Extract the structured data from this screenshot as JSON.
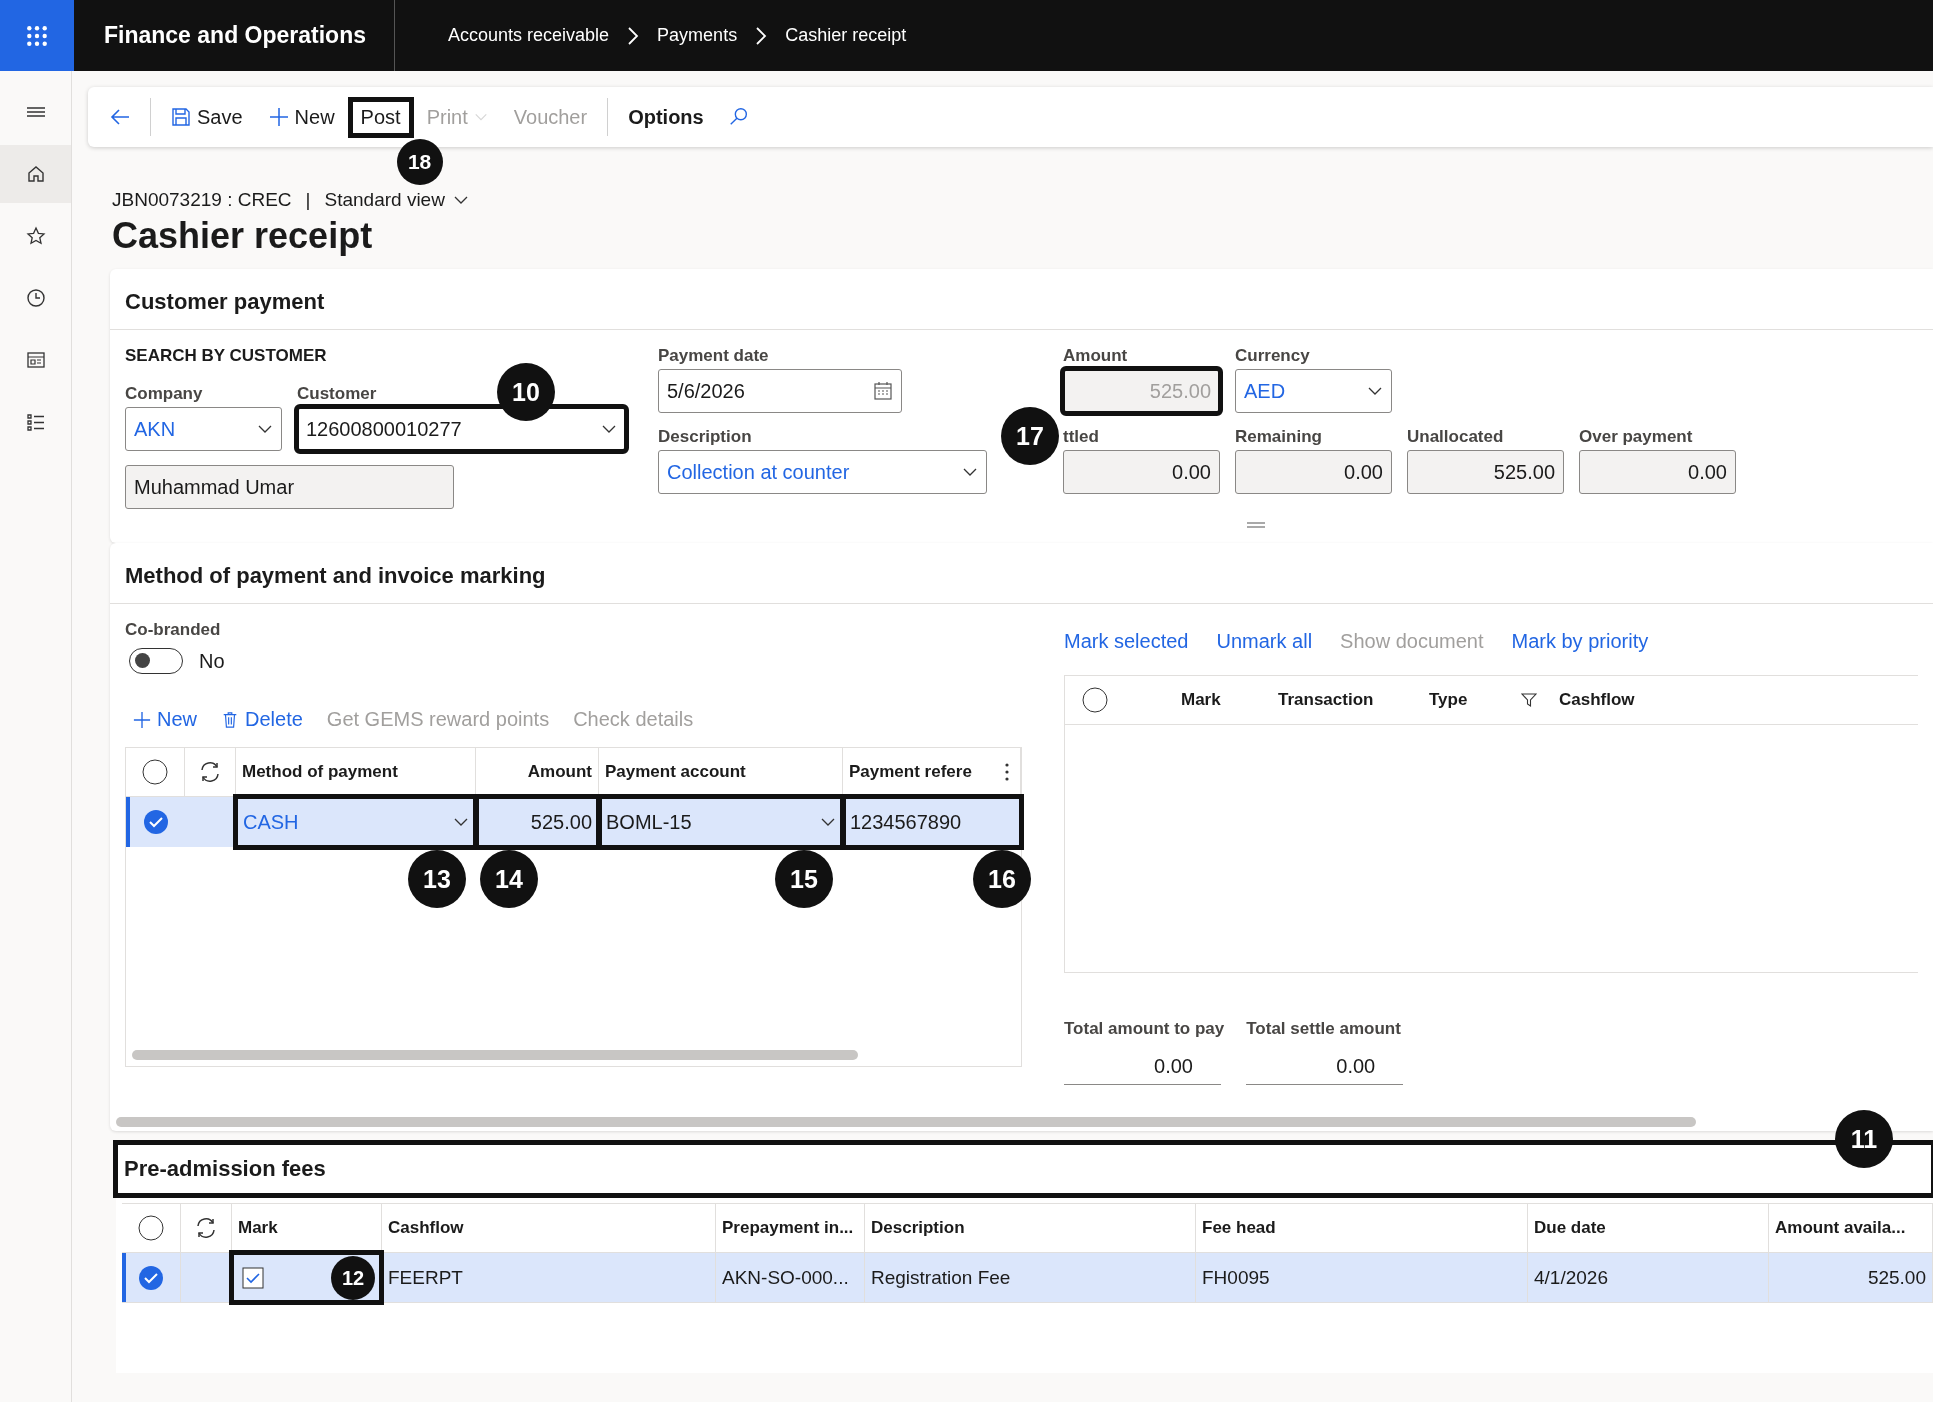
{
  "app": {
    "title": "Finance and Operations"
  },
  "breadcrumb": [
    "Accounts receivable",
    "Payments",
    "Cashier receipt"
  ],
  "nav": [
    {
      "kind": "menu",
      "selected": false
    },
    {
      "kind": "home",
      "selected": true
    },
    {
      "kind": "star",
      "selected": false
    },
    {
      "kind": "clock",
      "selected": false
    },
    {
      "kind": "workspace",
      "selected": false
    },
    {
      "kind": "list",
      "selected": false
    }
  ],
  "toolbar": [
    {
      "kind": "back",
      "disabled": false
    },
    {
      "kind": "save",
      "label": "Save",
      "disabled": false
    },
    {
      "kind": "new",
      "label": "New",
      "disabled": false
    },
    {
      "kind": "text",
      "label": "Post",
      "disabled": false,
      "callout": "18"
    },
    {
      "kind": "menu",
      "label": "Print",
      "disabled": true
    },
    {
      "kind": "text",
      "label": "Voucher",
      "disabled": true
    },
    {
      "kind": "bold",
      "label": "Options",
      "disabled": false
    },
    {
      "kind": "search",
      "disabled": false
    }
  ],
  "record": {
    "id": "JBN0073219 : CREC",
    "separator": "|",
    "view": "Standard view"
  },
  "page_title": "Cashier receipt",
  "customer_payment": {
    "title": "Customer payment",
    "search_heading": "SEARCH BY CUSTOMER",
    "company": {
      "label": "Company",
      "value": "AKN"
    },
    "customer": {
      "label": "Customer",
      "value": "12600800010277",
      "callout": "10"
    },
    "customer_name": "Muhammad Umar",
    "payment_date": {
      "label": "Payment date",
      "value": "5/6/2026"
    },
    "description": {
      "label": "Description",
      "value": "Collection at counter"
    },
    "amount": {
      "label": "Amount",
      "value": "525.00",
      "disabled": true,
      "callout": "17"
    },
    "currency": {
      "label": "Currency",
      "value": "AED"
    },
    "totals": [
      {
        "label": "ttled",
        "value": "0.00"
      },
      {
        "label": "Remaining",
        "value": "0.00"
      },
      {
        "label": "Unallocated",
        "value": "525.00"
      },
      {
        "label": "Over payment",
        "value": "0.00"
      }
    ]
  },
  "method_section": {
    "title": "Method of payment and invoice marking",
    "cobranded": {
      "label": "Co-branded",
      "on": false,
      "value": "No"
    },
    "actions": [
      {
        "kind": "add",
        "label": "New",
        "disabled": false
      },
      {
        "kind": "delete",
        "label": "Delete",
        "disabled": false
      },
      {
        "kind": "text",
        "label": "Get GEMS reward points",
        "disabled": true
      },
      {
        "kind": "text",
        "label": "Check details",
        "disabled": true
      }
    ],
    "columns": [
      "Method of payment",
      "Amount",
      "Payment account",
      "Payment refere"
    ],
    "rows": [
      {
        "selected": true,
        "cells": [
          {
            "value": "CASH",
            "kind": "lookup",
            "callout": "13"
          },
          {
            "value": "525.00",
            "kind": "number",
            "callout": "14"
          },
          {
            "value": "BOML-15",
            "kind": "dropdown",
            "callout": "15"
          },
          {
            "value": "1234567890",
            "kind": "text",
            "callout": "16"
          }
        ]
      }
    ],
    "mark_actions": [
      {
        "label": "Mark selected",
        "disabled": false
      },
      {
        "label": "Unmark all",
        "disabled": false
      },
      {
        "label": "Show document",
        "disabled": true
      },
      {
        "label": "Mark by priority",
        "disabled": false
      }
    ],
    "mark_columns": [
      "Mark",
      "Transaction",
      "Type",
      "Cashflow"
    ],
    "totals": [
      {
        "label": "Total amount to pay",
        "value": "0.00"
      },
      {
        "label": "Total settle amount",
        "value": "0.00"
      }
    ]
  },
  "fees": {
    "title": "Pre-admission fees",
    "callout": "11",
    "mark_column": "Mark",
    "columns": [
      "Cashflow",
      "Prepayment in...",
      "Description",
      "Fee head",
      "Due date",
      "Amount availa..."
    ],
    "rows": [
      {
        "selected": true,
        "checked": true,
        "mark_callout": "12",
        "cells": [
          "FEERPT",
          "AKN-SO-000...",
          "Registration Fee",
          "FH0095",
          "4/1/2026",
          "525.00"
        ]
      }
    ]
  }
}
